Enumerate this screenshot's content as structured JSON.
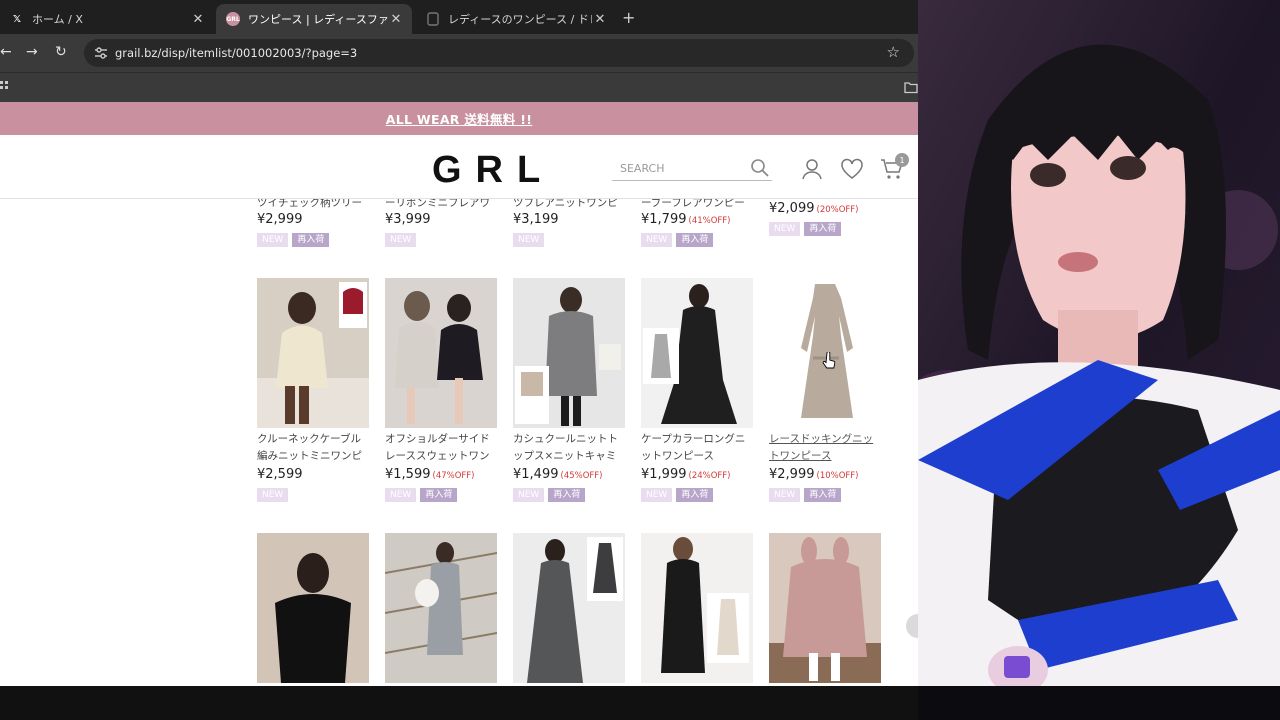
{
  "browser": {
    "tabs": [
      {
        "title": "ホーム / X",
        "favicon": "x-logo-icon",
        "active": false
      },
      {
        "title": "ワンピース | レディースファッション通販",
        "favicon": "grl-icon",
        "active": true
      },
      {
        "title": "レディースのワンピース / ドレス | ユナ",
        "favicon": "page-icon",
        "active": false
      }
    ],
    "url": "grail.bz/disp/itemlist/001002003/?page=3"
  },
  "site": {
    "banner": "ALL WEAR 送料無料 !!",
    "logo": "GRL",
    "search_placeholder": "SEARCH",
    "cart_count": "1",
    "accent": "#c9909f"
  },
  "products_top": [
    {
      "name": "ツイチェック柄ツリー",
      "price": "¥2,999",
      "off": "",
      "new": true,
      "restock": true
    },
    {
      "name": "ーリボンミニフレアワ",
      "price": "¥3,999",
      "off": "",
      "new": true,
      "restock": false
    },
    {
      "name": "ツフレアニットワンピ",
      "price": "¥3,199",
      "off": "",
      "new": true,
      "restock": false
    },
    {
      "name": "ーブーフレアワンピース",
      "price": "¥1,799",
      "off": "(41%OFF)",
      "new": true,
      "restock": true
    },
    {
      "name": "",
      "price": "¥2,099",
      "off": "(20%OFF)",
      "new": true,
      "restock": true
    }
  ],
  "products_mid": [
    {
      "name": "クルーネックケーブル編みニットミニワンピース",
      "price": "¥2,599",
      "off": "",
      "new": true,
      "restock": false
    },
    {
      "name": "オフショルダーサイドレーススウェットワンピ…",
      "price": "¥1,599",
      "off": "(47%OFF)",
      "new": true,
      "restock": true
    },
    {
      "name": "カシュクールニットトップス×ニットキャミワ…",
      "price": "¥1,499",
      "off": "(45%OFF)",
      "new": true,
      "restock": true
    },
    {
      "name": "ケープカラーロングニットワンピース",
      "price": "¥1,999",
      "off": "(24%OFF)",
      "new": true,
      "restock": true
    },
    {
      "name": "レースドッキングニットワンピース",
      "price": "¥2,999",
      "off": "(10%OFF)",
      "new": true,
      "restock": true
    }
  ],
  "labels": {
    "new": "NEW",
    "restock": "再入荷"
  }
}
